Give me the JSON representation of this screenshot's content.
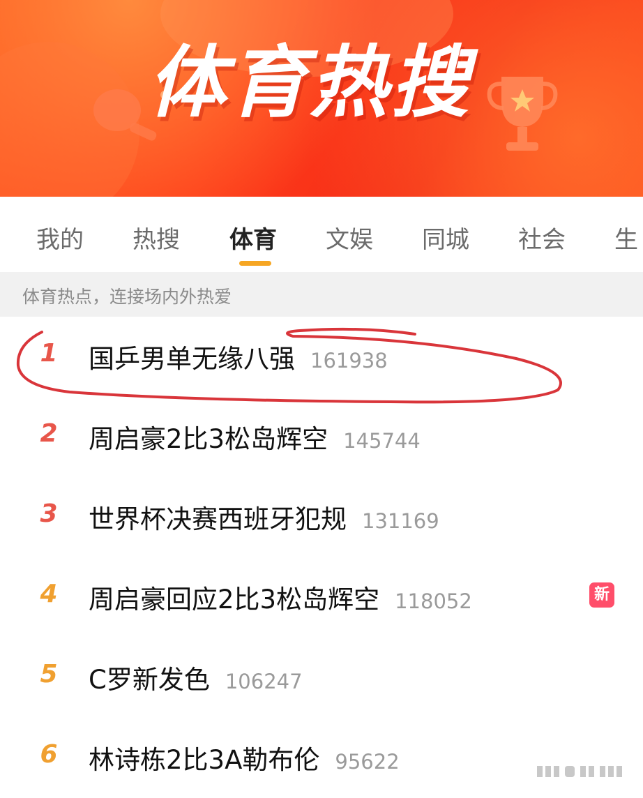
{
  "banner": {
    "title": "体育热搜"
  },
  "tabs": [
    {
      "label": "我的"
    },
    {
      "label": "热搜"
    },
    {
      "label": "体育"
    },
    {
      "label": "文娱"
    },
    {
      "label": "同城"
    },
    {
      "label": "社会"
    },
    {
      "label": "生"
    }
  ],
  "active_tab": "体育",
  "subheader": "体育热点，连接场内外热爱",
  "hot_list": [
    {
      "rank": "1",
      "title": "国乒男单无缘八强",
      "count": "161938",
      "rank_color": "#e8564a"
    },
    {
      "rank": "2",
      "title": "周启豪2比3松岛辉空",
      "count": "145744",
      "rank_color": "#e8564a"
    },
    {
      "rank": "3",
      "title": "世界杯决赛西班牙犯规",
      "count": "131169",
      "rank_color": "#e8564a"
    },
    {
      "rank": "4",
      "title": "周启豪回应2比3松岛辉空",
      "count": "118052",
      "rank_color": "#f0a030",
      "badge": "新"
    },
    {
      "rank": "5",
      "title": "C罗新发色",
      "count": "106247",
      "rank_color": "#f0a030"
    },
    {
      "rank": "6",
      "title": "林诗栋2比3A勒布伦",
      "count": "95622",
      "rank_color": "#f0a030"
    }
  ],
  "colors": {
    "accent": "#f6a623",
    "banner_red": "#f42a17",
    "badge_pink": "#ff4e6a"
  }
}
